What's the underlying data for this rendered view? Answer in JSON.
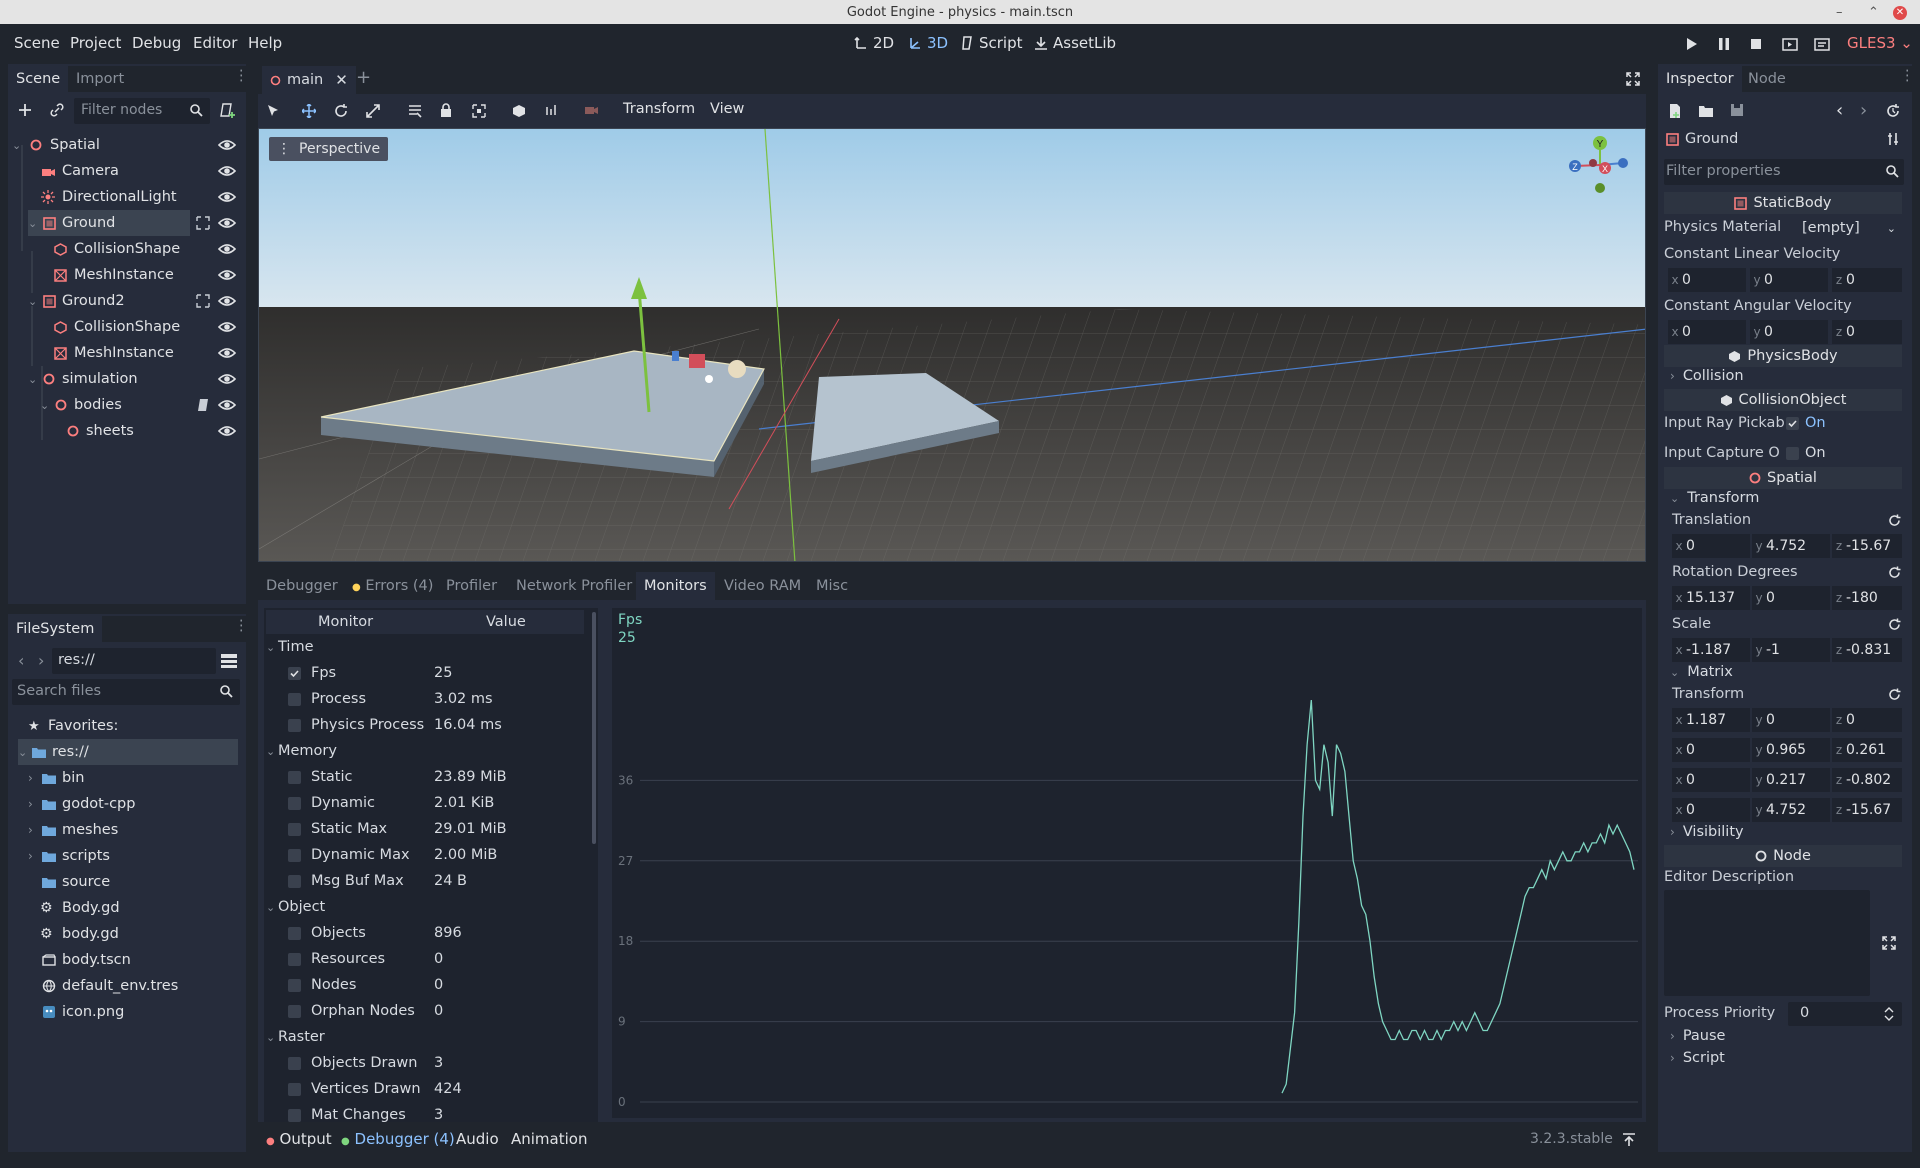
{
  "window": {
    "title": "Godot Engine - physics - main.tscn"
  },
  "menu": {
    "items": [
      "Scene",
      "Project",
      "Debug",
      "Editor",
      "Help"
    ]
  },
  "workspaces": {
    "w2d": "2D",
    "w3d": "3D",
    "script": "Script",
    "assetlib": "AssetLib"
  },
  "renderer": "GLES3",
  "scene_dock": {
    "tab_scene": "Scene",
    "tab_import": "Import",
    "filter_placeholder": "Filter nodes",
    "nodes": [
      {
        "label": "Spatial"
      },
      {
        "label": "Camera"
      },
      {
        "label": "DirectionalLight"
      },
      {
        "label": "Ground"
      },
      {
        "label": "CollisionShape"
      },
      {
        "label": "MeshInstance"
      },
      {
        "label": "Ground2"
      },
      {
        "label": "CollisionShape"
      },
      {
        "label": "MeshInstance"
      },
      {
        "label": "simulation"
      },
      {
        "label": "bodies"
      },
      {
        "label": "sheets"
      }
    ]
  },
  "filesystem": {
    "tab": "FileSystem",
    "path": "res://",
    "search_placeholder": "Search files",
    "favorites": "Favorites:",
    "items": [
      "res://",
      "bin",
      "godot-cpp",
      "meshes",
      "scripts",
      "source",
      "Body.gd",
      "body.gd",
      "body.tscn",
      "default_env.tres",
      "icon.png"
    ]
  },
  "editor_tab": {
    "label": "main"
  },
  "viewport_toolbar": {
    "transform": "Transform",
    "view": "View"
  },
  "viewport": {
    "perspective": "Perspective",
    "gizmo_y": "Y",
    "gizmo_x": "X",
    "gizmo_z": "Z"
  },
  "debugger": {
    "tabs": [
      "Debugger",
      "Errors (4)",
      "Profiler",
      "Network Profiler",
      "Monitors",
      "Video RAM",
      "Misc"
    ],
    "col_monitor": "Monitor",
    "col_value": "Value",
    "groups": [
      {
        "name": "Time",
        "rows": [
          {
            "label": "Fps",
            "value": "25",
            "checked": true
          },
          {
            "label": "Process",
            "value": "3.02 ms"
          },
          {
            "label": "Physics Process",
            "value": "16.04 ms"
          }
        ]
      },
      {
        "name": "Memory",
        "rows": [
          {
            "label": "Static",
            "value": "23.89 MiB"
          },
          {
            "label": "Dynamic",
            "value": "2.01 KiB"
          },
          {
            "label": "Static Max",
            "value": "29.01 MiB"
          },
          {
            "label": "Dynamic Max",
            "value": "2.00 MiB"
          },
          {
            "label": "Msg Buf Max",
            "value": "24 B"
          }
        ]
      },
      {
        "name": "Object",
        "rows": [
          {
            "label": "Objects",
            "value": "896"
          },
          {
            "label": "Resources",
            "value": "0"
          },
          {
            "label": "Nodes",
            "value": "0"
          },
          {
            "label": "Orphan Nodes",
            "value": "0"
          }
        ]
      },
      {
        "name": "Raster",
        "rows": [
          {
            "label": "Objects Drawn",
            "value": "3"
          },
          {
            "label": "Vertices Drawn",
            "value": "424"
          },
          {
            "label": "Mat Changes",
            "value": "3"
          }
        ]
      }
    ]
  },
  "chart_data": {
    "type": "line",
    "title": "Fps",
    "current_value": "25",
    "ylim": [
      0,
      45
    ],
    "yticks": [
      "36",
      "27",
      "18",
      "9",
      "0"
    ],
    "series": [
      {
        "name": "Fps",
        "color": "#7fd6c2",
        "values": [
          1,
          2,
          6,
          10,
          20,
          32,
          40,
          45,
          36,
          35,
          40,
          38,
          32,
          40,
          39,
          37,
          32,
          27,
          25,
          22,
          21,
          18,
          14,
          11,
          9,
          8,
          7,
          7,
          8,
          7,
          7,
          8,
          8,
          7,
          8,
          7,
          7,
          8,
          7,
          8,
          8,
          9,
          8,
          9,
          8,
          9,
          10,
          9,
          8,
          8,
          9,
          10,
          11,
          13,
          15,
          17,
          19,
          21,
          23,
          24,
          24,
          25,
          26,
          25,
          27,
          26,
          27,
          28,
          27,
          27,
          28,
          28,
          29,
          28,
          29,
          29,
          30,
          29,
          31,
          30,
          31,
          30,
          29,
          28,
          26
        ]
      }
    ]
  },
  "bottom_panel": {
    "output": "Output",
    "debugger": "Debugger (4)",
    "audio": "Audio",
    "animation": "Animation",
    "version": "3.2.3.stable"
  },
  "inspector": {
    "tab_inspector": "Inspector",
    "tab_node": "Node",
    "object": "Ground",
    "filter_placeholder": "Filter properties",
    "sec_staticbody": "StaticBody",
    "physics_material_label": "Physics Material",
    "physics_material_value": "[empty]",
    "const_lin_label": "Constant Linear Velocity",
    "const_lin": {
      "x": "0",
      "y": "0",
      "z": "0"
    },
    "const_ang_label": "Constant Angular Velocity",
    "const_ang": {
      "x": "0",
      "y": "0",
      "z": "0"
    },
    "sec_physicsbody": "PhysicsBody",
    "collision": "Collision",
    "sec_collisionobject": "CollisionObject",
    "ray_pickable_label": "Input Ray Pickab",
    "ray_pickable_value": "On",
    "capture_label": "Input Capture O",
    "capture_value": "On",
    "sec_spatial": "Spatial",
    "transform_group": "Transform",
    "translation_label": "Translation",
    "translation": {
      "x": "0",
      "y": "4.752",
      "z": "-15.67"
    },
    "rotation_label": "Rotation Degrees",
    "rotation": {
      "x": "15.137",
      "y": "0",
      "z": "-180"
    },
    "scale_label": "Scale",
    "scale": {
      "x": "-1.187",
      "y": "-1",
      "z": "-0.831"
    },
    "matrix_group": "Matrix",
    "matrix_transform_label": "Transform",
    "matrix_rows": [
      {
        "x": "1.187",
        "y": "0",
        "z": "0"
      },
      {
        "x": "0",
        "y": "0.965",
        "z": "0.261"
      },
      {
        "x": "0",
        "y": "0.217",
        "z": "-0.802"
      },
      {
        "x": "0",
        "y": "4.752",
        "z": "-15.67"
      }
    ],
    "visibility": "Visibility",
    "sec_node": "Node",
    "editor_description": "Editor Description",
    "process_priority_label": "Process Priority",
    "process_priority_value": "0",
    "pause": "Pause",
    "script": "Script"
  },
  "colors": {
    "accent": "#8cc2ff",
    "node_icon": "#fc7f7f",
    "background": "#20252d",
    "panel": "#262c3b"
  }
}
